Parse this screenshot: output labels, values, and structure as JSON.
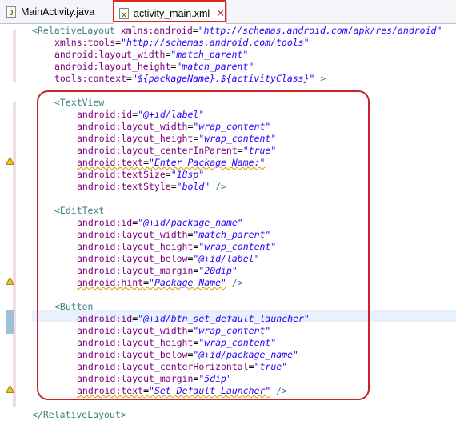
{
  "tabs": [
    {
      "label": "MainActivity.java",
      "icon": "java-file-icon",
      "icon_glyph": "J",
      "active": false
    },
    {
      "label": "activity_main.xml",
      "icon": "xml-file-icon",
      "icon_glyph": "x",
      "active": true,
      "close_glyph": "✕"
    }
  ],
  "colors": {
    "tag": "#3f7f7f",
    "attribute": "#7f007f",
    "string": "#2a00ff",
    "highlight_box": "#c8232b"
  },
  "code": {
    "l01": {
      "a": "<RelativeLayout",
      "b": " xmlns:android",
      "c": "=",
      "d": "\"http://schemas.android.com/apk/res/android\""
    },
    "l02": {
      "b": "xmlns:tools",
      "c": "=",
      "d": "\"http://schemas.android.com/tools\""
    },
    "l03": {
      "b": "android:layout_width",
      "c": "=",
      "d": "\"match_parent\""
    },
    "l04": {
      "b": "android:layout_height",
      "c": "=",
      "d": "\"match_parent\""
    },
    "l05": {
      "b": "tools:context",
      "c": "=",
      "d": "\"${packageName}.${activityClass}\"",
      "e": " >"
    },
    "l07": {
      "a": "<TextView"
    },
    "l08": {
      "b": "android:id",
      "c": "=",
      "d": "\"@+id/label\""
    },
    "l09": {
      "b": "android:layout_width",
      "c": "=",
      "d": "\"wrap_content\""
    },
    "l10": {
      "b": "android:layout_height",
      "c": "=",
      "d": "\"wrap_content\""
    },
    "l11": {
      "b": "android:layout_centerInParent",
      "c": "=",
      "d": "\"true\""
    },
    "l12": {
      "b": "android:text",
      "c": "=",
      "d": "\"Enter Package Name:\""
    },
    "l13": {
      "b": "android:textSize",
      "c": "=",
      "d": "\"18sp\""
    },
    "l14": {
      "b": "android:textStyle",
      "c": "=",
      "d": "\"bold\"",
      "e": " />"
    },
    "l16": {
      "a": "<EditText"
    },
    "l17": {
      "b": "android:id",
      "c": "=",
      "d": "\"@+id/package_name\""
    },
    "l18": {
      "b": "android:layout_width",
      "c": "=",
      "d": "\"match_parent\""
    },
    "l19": {
      "b": "android:layout_height",
      "c": "=",
      "d": "\"wrap_content\""
    },
    "l20": {
      "b": "android:layout_below",
      "c": "=",
      "d": "\"@+id/label\""
    },
    "l21": {
      "b": "android:layout_margin",
      "c": "=",
      "d": "\"20dip\""
    },
    "l22": {
      "b": "android:hint",
      "c": "=",
      "d": "\"Package Name\"",
      "e": " />"
    },
    "l24": {
      "a": "<Button"
    },
    "l25": {
      "b": "android:id",
      "c": "=",
      "d": "\"@+id/btn_set_default_launcher\""
    },
    "l26": {
      "b": "android:layout_width",
      "c": "=",
      "d": "\"wrap_content\""
    },
    "l27": {
      "b": "android:layout_height",
      "c": "=",
      "d": "\"wrap_content\""
    },
    "l28": {
      "b": "android:layout_below",
      "c": "=",
      "d": "\"@+id/package_name\""
    },
    "l29": {
      "b": "android:layout_centerHorizontal",
      "c": "=",
      "d": "\"true\""
    },
    "l30": {
      "b": "android:layout_margin",
      "c": "=",
      "d": "\"5dip\""
    },
    "l31": {
      "b": "android:text",
      "c": "=",
      "d": "\"Set Default Launcher\"",
      "e": " />"
    },
    "l33": {
      "a": "</RelativeLayout>"
    }
  },
  "gutter": {
    "warning_icon": "warning-icon"
  }
}
